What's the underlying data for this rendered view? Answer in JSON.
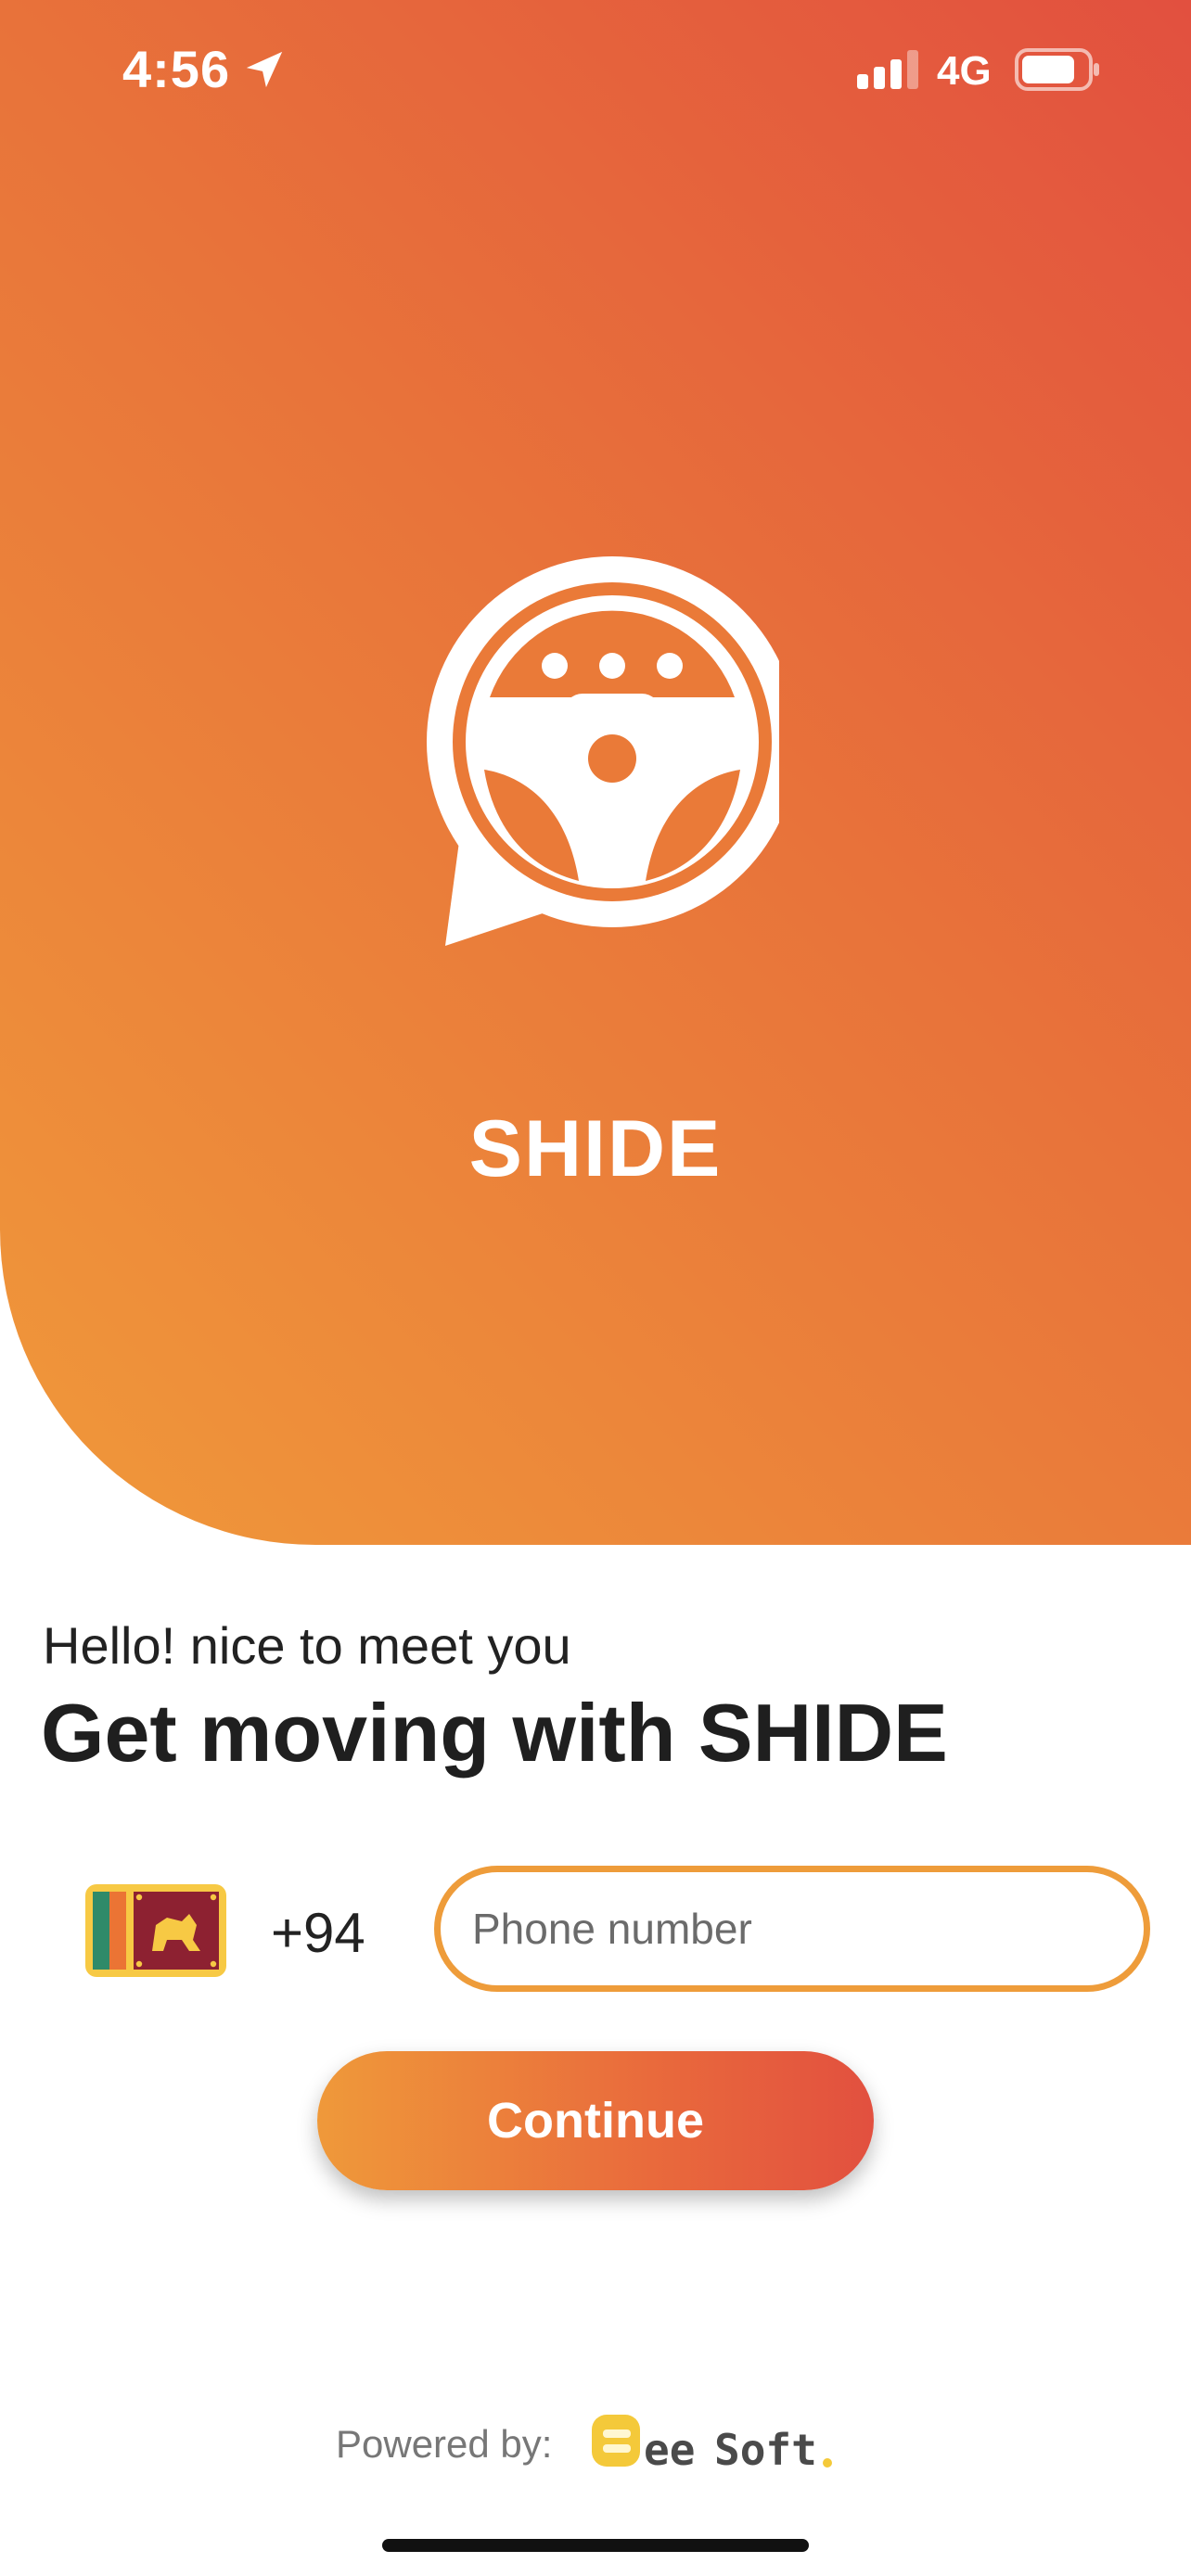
{
  "status_bar": {
    "time": "4:56",
    "network": "4G",
    "signal_bars": 3,
    "battery_level": 0.8
  },
  "hero": {
    "app_name": "SHIDE",
    "logo_icon": "steering-wheel-chat-bubble-icon",
    "gradient_colors": [
      "#e2503f",
      "#e8733a",
      "#f0993a"
    ]
  },
  "intro": {
    "greeting": "Hello! nice to meet you",
    "headline": "Get moving with SHIDE"
  },
  "phone_form": {
    "flag_icon": "sri-lanka-flag-icon",
    "country_code": "+94",
    "phone_placeholder": "Phone number",
    "phone_value": "",
    "continue_label": "Continue"
  },
  "footer": {
    "powered_label": "Powered by:",
    "brand_name": "Bee Soft."
  },
  "colors": {
    "accent_orange": "#ee9c3a",
    "accent_red": "#e2503f",
    "brand_yellow": "#f4c93a"
  }
}
